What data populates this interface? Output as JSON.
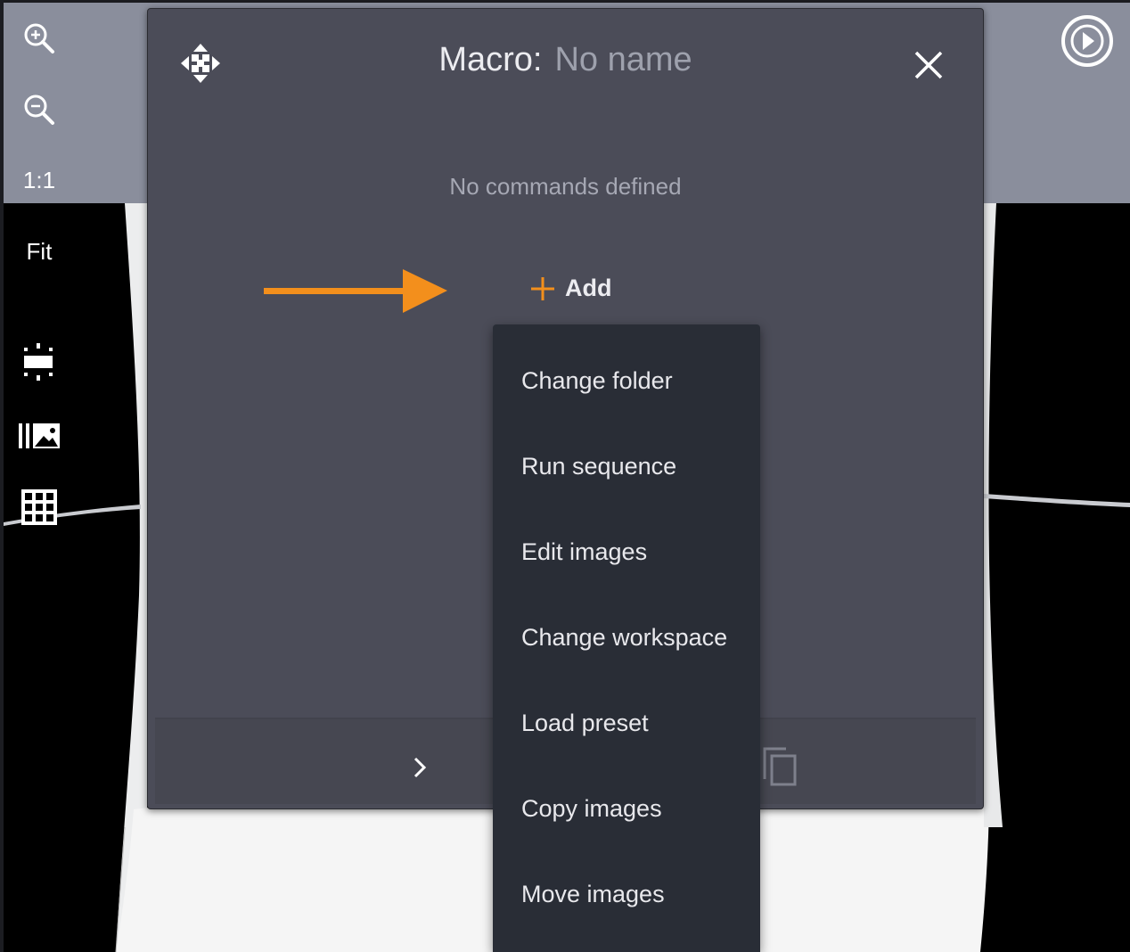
{
  "toolbar": {
    "zoom_in_icon": "zoom-in-icon",
    "zoom_out_icon": "zoom-out-icon",
    "actual_size_label": "1:1",
    "fit_label": "Fit",
    "compare_icon": "split-view-icon",
    "filmstrip_icon": "filmstrip-icon",
    "grid_icon": "grid-icon",
    "play_icon": "play-icon"
  },
  "dialog": {
    "title_label": "Macro:",
    "title_name": "No name",
    "empty_message": "No commands defined",
    "add_label": "Add",
    "move_icon": "move-icon",
    "close_icon": "close-icon",
    "expand_icon": "chevron-right-icon",
    "copy_icon": "copy-icon"
  },
  "add_menu": {
    "items": [
      {
        "label": "Change folder"
      },
      {
        "label": "Run sequence"
      },
      {
        "label": "Edit images"
      },
      {
        "label": "Change workspace"
      },
      {
        "label": "Load preset"
      },
      {
        "label": "Copy images"
      },
      {
        "label": "Move images"
      }
    ]
  },
  "colors": {
    "accent": "#f38f1c",
    "dialog_bg": "#4b4c58",
    "menu_bg": "#292d36",
    "toolbar_bg": "#8a8e9c"
  }
}
